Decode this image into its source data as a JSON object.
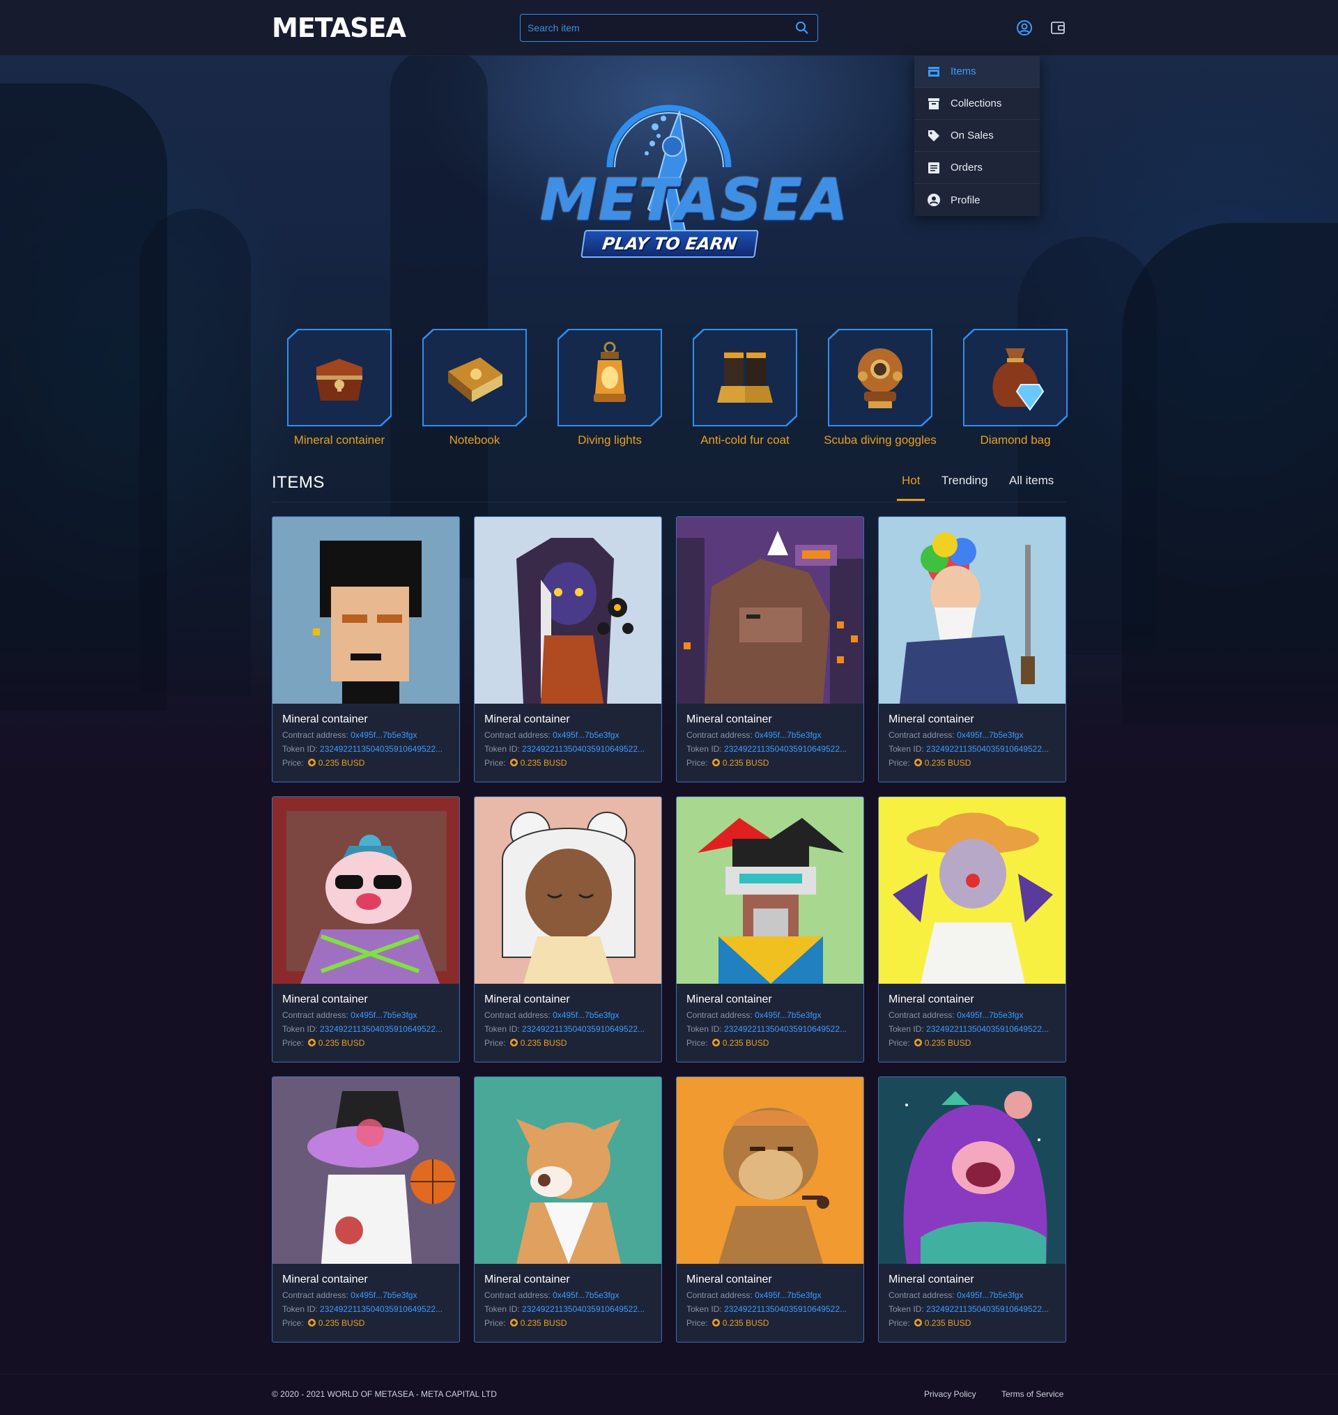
{
  "header": {
    "logo": "METASEA",
    "search_placeholder": "Search item"
  },
  "menu": {
    "items": [
      {
        "label": "Items",
        "icon": "store-icon",
        "active": true
      },
      {
        "label": "Collections",
        "icon": "archive-icon",
        "active": false
      },
      {
        "label": "On Sales",
        "icon": "tag-icon",
        "active": false
      },
      {
        "label": "Orders",
        "icon": "receipt-icon",
        "active": false
      },
      {
        "label": "Profile",
        "icon": "account-circle-icon",
        "active": false
      }
    ]
  },
  "hero": {
    "title": "METASEA",
    "ribbon": "PLAY TO EARN"
  },
  "categories": [
    {
      "label": "Mineral container",
      "icon": "treasure-chest-icon"
    },
    {
      "label": "Notebook",
      "icon": "book-icon"
    },
    {
      "label": "Diving lights",
      "icon": "lantern-icon"
    },
    {
      "label": "Anti-cold fur coat",
      "icon": "boots-icon"
    },
    {
      "label": "Scuba diving goggles",
      "icon": "diving-helmet-icon"
    },
    {
      "label": "Diamond bag",
      "icon": "diamond-bag-icon"
    }
  ],
  "items_section": {
    "title": "ITEMS",
    "tabs": [
      "Hot",
      "Trending",
      "All items"
    ],
    "active_tab": "Hot",
    "labels": {
      "contract": "Contract address:",
      "token": "Token ID:",
      "price": "Price:"
    }
  },
  "cards": [
    {
      "name": "Mineral container",
      "contract": "0x495f...7b5e3fgx",
      "token": "2324922113504035910649522...",
      "price": "0.235 BUSD",
      "art": "pixel-punk"
    },
    {
      "name": "Mineral container",
      "contract": "0x495f...7b5e3fgx",
      "token": "2324922113504035910649522...",
      "price": "0.235 BUSD",
      "art": "hooded-mage"
    },
    {
      "name": "Mineral container",
      "contract": "0x495f...7b5e3fgx",
      "token": "2324922113504035910649522...",
      "price": "0.235 BUSD",
      "art": "pixel-kong"
    },
    {
      "name": "Mineral container",
      "contract": "0x495f...7b5e3fgx",
      "token": "2324922113504035910649522...",
      "price": "0.235 BUSD",
      "art": "rainbow-wizard"
    },
    {
      "name": "Mineral container",
      "contract": "0x495f...7b5e3fgx",
      "token": "2324922113504035910649522...",
      "price": "0.235 BUSD",
      "art": "pig-sunglasses"
    },
    {
      "name": "Mineral container",
      "contract": "0x495f...7b5e3fgx",
      "token": "2324922113504035910649522...",
      "price": "0.235 BUSD",
      "art": "white-hair-girl"
    },
    {
      "name": "Mineral container",
      "contract": "0x495f...7b5e3fgx",
      "token": "2324922113504035910649522...",
      "price": "0.235 BUSD",
      "art": "pixel-jester"
    },
    {
      "name": "Mineral container",
      "contract": "0x495f...7b5e3fgx",
      "token": "2324922113504035910649522...",
      "price": "0.235 BUSD",
      "art": "straw-hat-clown"
    },
    {
      "name": "Mineral container",
      "contract": "0x495f...7b5e3fgx",
      "token": "2324922113504035910649522...",
      "price": "0.235 BUSD",
      "art": "purple-croc"
    },
    {
      "name": "Mineral container",
      "contract": "0x495f...7b5e3fgx",
      "token": "2324922113504035910649522...",
      "price": "0.235 BUSD",
      "art": "shiba-dog"
    },
    {
      "name": "Mineral container",
      "contract": "0x495f...7b5e3fgx",
      "token": "2324922113504035910649522...",
      "price": "0.235 BUSD",
      "art": "bored-ape"
    },
    {
      "name": "Mineral container",
      "contract": "0x495f...7b5e3fgx",
      "token": "2324922113504035910649522...",
      "price": "0.235 BUSD",
      "art": "purple-dino"
    }
  ],
  "footer": {
    "copyright": "© 2020 - 2021 WORLD OF METASEA - META CAPITAL LTD",
    "privacy": "Privacy Policy",
    "terms": "Terms of Service"
  },
  "colors": {
    "accent_blue": "#2f8ff0",
    "accent_gold": "#e8a020",
    "card_bg": "#1e2438",
    "page_bg": "#150f24"
  }
}
